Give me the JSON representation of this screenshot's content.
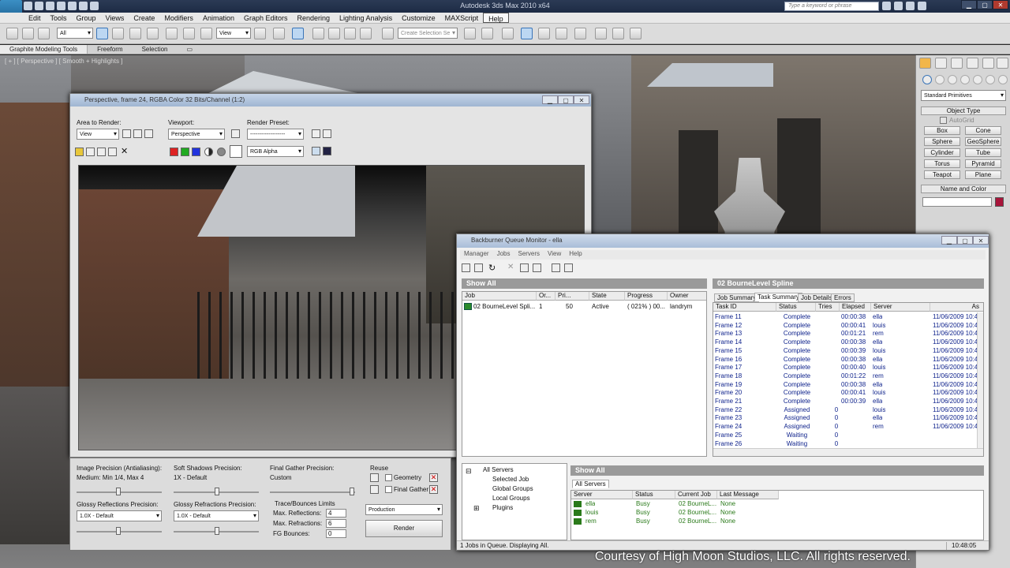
{
  "app": {
    "title": "Autodesk 3ds Max 2010 x64",
    "search_placeholder": "Type a keyword or phrase",
    "logo": "3DS"
  },
  "menu": [
    "Edit",
    "Tools",
    "Group",
    "Views",
    "Create",
    "Modifiers",
    "Animation",
    "Graph Editors",
    "Rendering",
    "Lighting Analysis",
    "Customize",
    "MAXScript",
    "Help"
  ],
  "toolbar": {
    "filter": "All",
    "refcoord": "View",
    "selset": "Create Selection Se"
  },
  "ribbon": [
    "Graphite Modeling Tools",
    "Freeform",
    "Selection"
  ],
  "viewport": {
    "label": "[ + ] [ Perspective ] [ Smooth + Highlights ]"
  },
  "command_panel": {
    "dropdown": "Standard Primitives",
    "object_type_title": "Object Type",
    "autogrid": "AutoGrid",
    "buttons": [
      "Box",
      "Cone",
      "Sphere",
      "GeoSphere",
      "Cylinder",
      "Tube",
      "Torus",
      "Pyramid",
      "Teapot",
      "Plane"
    ],
    "name_color_title": "Name and Color"
  },
  "render_window": {
    "title": "Perspective, frame 24, RGBA Color 32 Bits/Channel (1:2)",
    "area_label": "Area to Render:",
    "area_value": "View",
    "viewport_label": "Viewport:",
    "viewport_value": "Perspective",
    "preset_label": "Render Preset:",
    "preset_value": "-------------------",
    "channel_value": "RGB Alpha"
  },
  "render_settings": {
    "image_precision_label": "Image Precision (Antialiasing):",
    "image_precision_value": "Medium: Min 1/4, Max 4",
    "soft_shadows_label": "Soft Shadows Precision:",
    "soft_shadows_value": "1X - Default",
    "final_gather_label": "Final Gather Precision:",
    "final_gather_value": "Custom",
    "reuse_label": "Reuse",
    "geometry_label": "Geometry",
    "final_gather_check": "Final Gather",
    "glossy_refl_label": "Glossy Reflections Precision:",
    "glossy_refl_value": "1.0X - Default",
    "glossy_refr_label": "Glossy Refractions Precision:",
    "glossy_refr_value": "1.0X - Default",
    "trace_label": "Trace/Bounces Limits",
    "max_refl_label": "Max. Reflections:",
    "max_refl_value": "4",
    "max_refr_label": "Max. Refractions:",
    "max_refr_value": "6",
    "fg_bounces_label": "FG Bounces:",
    "fg_bounces_value": "0",
    "mode_value": "Production",
    "render_button": "Render"
  },
  "backburner": {
    "title": "Backburner Queue Monitor - ella",
    "menu": [
      "Manager",
      "Jobs",
      "Servers",
      "View",
      "Help"
    ],
    "show_all": "Show All",
    "job_headers": [
      "Job",
      "Or...",
      "Pri...",
      "State",
      "Progress",
      "Owner"
    ],
    "jobs": [
      [
        "02 BourneLevel Spli...",
        "1",
        "50",
        "Active",
        "( 021% ) 00...",
        "landrym"
      ]
    ],
    "job_panel_title": "02 BourneLevel Spline",
    "tabs": [
      "Job Summary",
      "Task Summary",
      "Job Details",
      "Errors"
    ],
    "task_headers": [
      "Task ID",
      "Status",
      "Tries",
      "Elapsed",
      "Server",
      "As"
    ],
    "tasks": [
      [
        "Frame 11",
        "Complete",
        "",
        "00:00:38",
        "ella",
        "11/06/2009 10:4"
      ],
      [
        "Frame 12",
        "Complete",
        "",
        "00:00:41",
        "louis",
        "11/06/2009 10:4"
      ],
      [
        "Frame 13",
        "Complete",
        "",
        "00:01:21",
        "rem",
        "11/06/2009 10:4"
      ],
      [
        "Frame 14",
        "Complete",
        "",
        "00:00:38",
        "ella",
        "11/06/2009 10:4"
      ],
      [
        "Frame 15",
        "Complete",
        "",
        "00:00:39",
        "louis",
        "11/06/2009 10:4"
      ],
      [
        "Frame 16",
        "Complete",
        "",
        "00:00:38",
        "ella",
        "11/06/2009 10:4"
      ],
      [
        "Frame 17",
        "Complete",
        "",
        "00:00:40",
        "louis",
        "11/06/2009 10:4"
      ],
      [
        "Frame 18",
        "Complete",
        "",
        "00:01:22",
        "rem",
        "11/06/2009 10:4"
      ],
      [
        "Frame 19",
        "Complete",
        "",
        "00:00:38",
        "ella",
        "11/06/2009 10:4"
      ],
      [
        "Frame 20",
        "Complete",
        "",
        "00:00:41",
        "louis",
        "11/06/2009 10:4"
      ],
      [
        "Frame 21",
        "Complete",
        "",
        "00:00:39",
        "ella",
        "11/06/2009 10:4"
      ],
      [
        "Frame 22",
        "Assigned",
        "0",
        "",
        "louis",
        "11/06/2009 10:4"
      ],
      [
        "Frame 23",
        "Assigned",
        "0",
        "",
        "ella",
        "11/06/2009 10:4"
      ],
      [
        "Frame 24",
        "Assigned",
        "0",
        "",
        "rem",
        "11/06/2009 10:4"
      ],
      [
        "Frame 25",
        "Waiting",
        "0",
        "",
        "",
        ""
      ],
      [
        "Frame 26",
        "Waiting",
        "0",
        "",
        "",
        ""
      ]
    ],
    "tree": [
      "All Servers",
      "Selected Job",
      "Global Groups",
      "Local Groups",
      "Plugins"
    ],
    "servers_title": "Show All",
    "servers_tab": "All Servers",
    "server_headers": [
      "Server",
      "Status",
      "Current Job",
      "Last Message"
    ],
    "servers": [
      [
        "ella",
        "Busy",
        "02 BourneL...",
        "None"
      ],
      [
        "louis",
        "Busy",
        "02 BourneL...",
        "None"
      ],
      [
        "rem",
        "Busy",
        "02 BourneL...",
        "None"
      ]
    ],
    "status_text": "1 Jobs in Queue. Displaying All.",
    "clock": "10:48:05"
  },
  "credit": "Courtesy of High Moon Studios, LLC. All rights reserved.",
  "colors": {
    "accent": "#0b1f8a",
    "status_green": "#2a7a1a",
    "color_swatch": "#a8143a"
  }
}
